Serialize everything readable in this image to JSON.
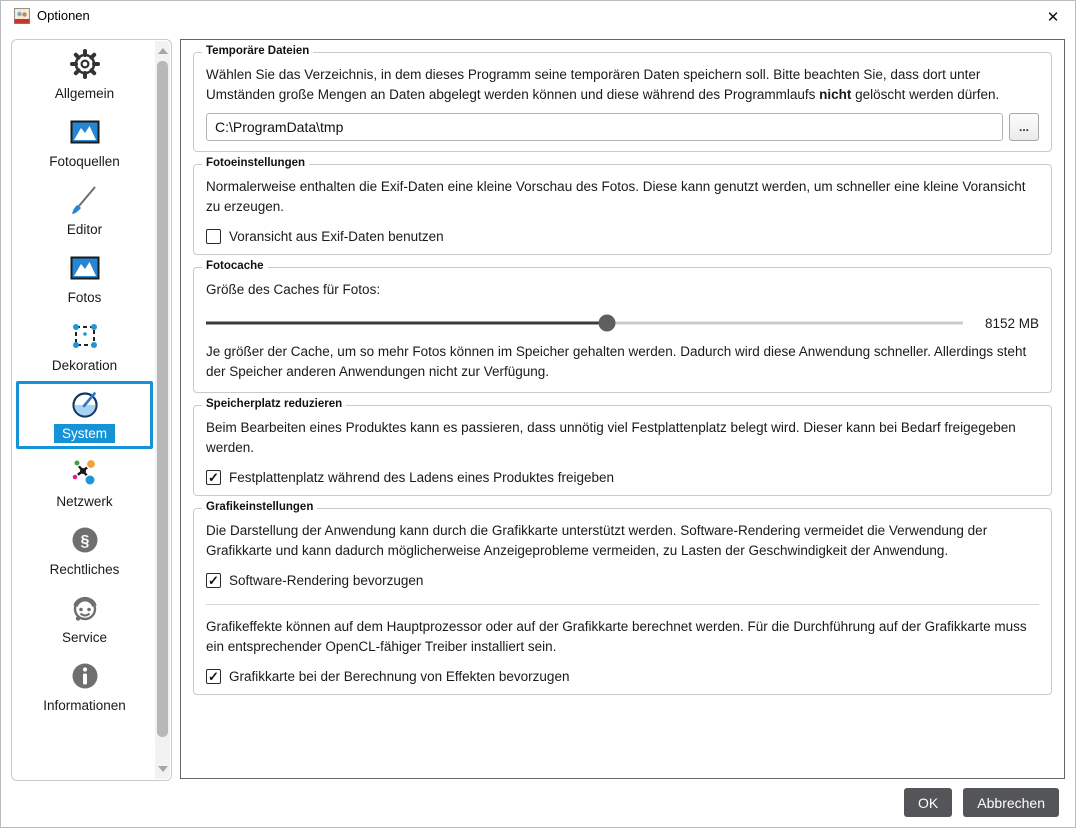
{
  "window": {
    "title": "Optionen",
    "close_glyph": "✕"
  },
  "sidebar": {
    "items": [
      {
        "id": "allgemein",
        "label": "Allgemein",
        "selected": false
      },
      {
        "id": "fotoquellen",
        "label": "Fotoquellen",
        "selected": false
      },
      {
        "id": "editor",
        "label": "Editor",
        "selected": false
      },
      {
        "id": "fotos",
        "label": "Fotos",
        "selected": false
      },
      {
        "id": "dekoration",
        "label": "Dekoration",
        "selected": false
      },
      {
        "id": "system",
        "label": "System",
        "selected": true
      },
      {
        "id": "netzwerk",
        "label": "Netzwerk",
        "selected": false
      },
      {
        "id": "rechtliches",
        "label": "Rechtliches",
        "selected": false
      },
      {
        "id": "service",
        "label": "Service",
        "selected": false
      },
      {
        "id": "informationen",
        "label": "Informationen",
        "selected": false
      }
    ]
  },
  "groups": {
    "temp": {
      "legend": "Temporäre Dateien",
      "text1": "Wählen Sie das Verzeichnis, in dem dieses Programm seine temporären Daten speichern soll. Bitte beachten Sie, dass dort unter Umständen große Mengen an Daten abgelegt werden können und diese während des Programmlaufs ",
      "bold": "nicht",
      "text2": " gelöscht werden dürfen.",
      "path": "C:\\ProgramData\\tmp",
      "browse": "..."
    },
    "photo": {
      "legend": "Fotoeinstellungen",
      "text": "Normalerweise enthalten die Exif-Daten eine kleine Vorschau des Fotos. Diese kann genutzt werden, um schneller eine kleine Voransicht zu erzeugen.",
      "checkbox": "Voransicht aus Exif-Daten benutzen",
      "checked": ""
    },
    "cache": {
      "legend": "Fotocache",
      "label": "Größe des Caches für Fotos:",
      "value": "8152 MB",
      "percent": 53,
      "text": "Je größer der Cache, um so mehr Fotos können im Speicher gehalten werden. Dadurch wird diese Anwendung schneller. Allerdings steht der Speicher anderen Anwendungen nicht zur Verfügung."
    },
    "disk": {
      "legend": "Speicherplatz reduzieren",
      "text": "Beim Bearbeiten eines Produktes kann es passieren, dass unnötig viel Festplattenplatz belegt wird. Dieser kann bei Bedarf freigegeben werden.",
      "checkbox": "Festplattenplatz während des Ladens eines Produktes freigeben",
      "checked": "✓"
    },
    "gfx": {
      "legend": "Grafikeinstellungen",
      "text1": "Die Darstellung der Anwendung kann durch die Grafikkarte unterstützt werden. Software-Rendering vermeidet die Verwendung der Grafikkarte und kann dadurch möglicherweise Anzeigeprobleme vermeiden, zu Lasten der Geschwindigkeit der Anwendung.",
      "checkbox1": "Software-Rendering bevorzugen",
      "checked1": "✓",
      "text2": "Grafikeffekte können auf dem Hauptprozessor oder auf der Grafikkarte berechnet werden. Für die Durchführung auf der Grafikkarte muss ein entsprechender OpenCL-fähiger Treiber installiert sein.",
      "checkbox2": "Grafikkarte bei der Berechnung von Effekten bevorzugen",
      "checked2": "✓"
    }
  },
  "footer": {
    "ok": "OK",
    "cancel": "Abbrechen"
  },
  "colors": {
    "accent": "#1593d6",
    "icon_blue": "#2786d3",
    "button_gray": "#545559"
  }
}
